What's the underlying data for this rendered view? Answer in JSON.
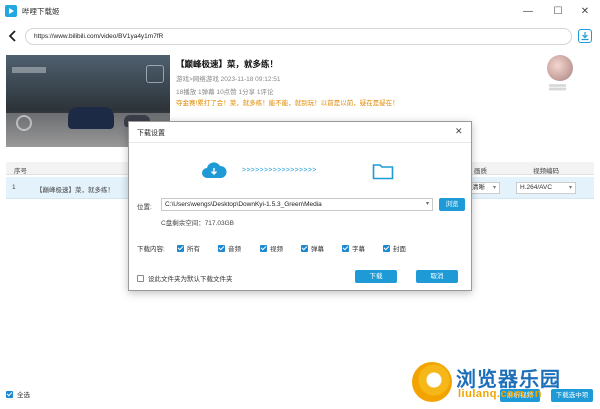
{
  "window": {
    "title": "哔哩下载姬",
    "minimize": "—",
    "maximize": "☐",
    "close": "✕"
  },
  "address": {
    "url": "https://www.bilibili.com/video/BV1ya4y1m7fR"
  },
  "video": {
    "title": "【巅峰极速】菜，就多练！",
    "meta": "游戏>网络游戏    2023-11-18 09:12:51",
    "stats": "18播放   1弹幕   10点赞   1分享   1评论",
    "description": "夺金赛!累打了会！菜，就多练！能不能，就别玩！以前是以前，疑在是疑在！"
  },
  "table": {
    "headers": {
      "index": "序号",
      "quality": "画质",
      "codec": "视频编码"
    },
    "rows": [
      {
        "index": "1",
        "title": "【巅峰极速】菜，就多练！",
        "quality": "清晰",
        "codec": "H.264/AVC"
      }
    ]
  },
  "bottom": {
    "select_all": "全选",
    "parse_btn": "解析视频",
    "download_btn": "下载选中项"
  },
  "dialog": {
    "title": "下载设置",
    "close": "✕",
    "arrows": ">>>>>>>>>>>>>>>>>",
    "location_label": "位置:",
    "path": "C:\\Users\\wengs\\Desktop\\DownKyi-1.5.3_Green\\Media",
    "browse": "浏览",
    "disk_free": "C盘剩余空间：717.03GB",
    "content_label": "下载内容:",
    "options": [
      "所有",
      "音频",
      "视频",
      "弹幕",
      "字幕",
      "封面"
    ],
    "default_folder": "设此文件夹为默认下载文件夹",
    "download": "下载",
    "cancel": "取消"
  },
  "watermark": {
    "text": "浏览器乐园",
    "sub": "liulanq.com.cn"
  },
  "colors": {
    "accent": "#1e9bd7",
    "row_selected": "#e4f2fb",
    "desc_orange": "#e08a00"
  }
}
